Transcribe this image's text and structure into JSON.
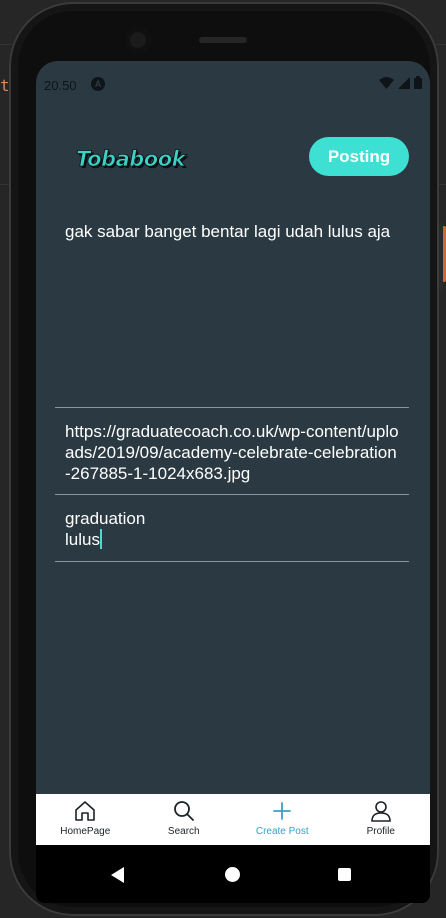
{
  "statusbar": {
    "time": "20.50",
    "a_icon": "A"
  },
  "header": {
    "logo": "Tobabook",
    "posting_label": "Posting"
  },
  "form": {
    "caption": "gak sabar banget bentar lagi udah lulus aja",
    "image_url": "https://graduatecoach.co.uk/wp-content/uploads/2019/09/academy-celebrate-celebration-267885-1-1024x683.jpg",
    "tags_line1": "graduation",
    "tags_line2": "lulus"
  },
  "bottom_nav": {
    "items": [
      {
        "label": "HomePage",
        "icon": "home-icon"
      },
      {
        "label": "Search",
        "icon": "search-icon"
      },
      {
        "label": "Create Post",
        "icon": "plus-icon"
      },
      {
        "label": "Profile",
        "icon": "profile-icon"
      }
    ],
    "active_color": "#3a9ec7"
  },
  "colors": {
    "accent": "#3ee0d3",
    "background": "#2b3a42"
  }
}
